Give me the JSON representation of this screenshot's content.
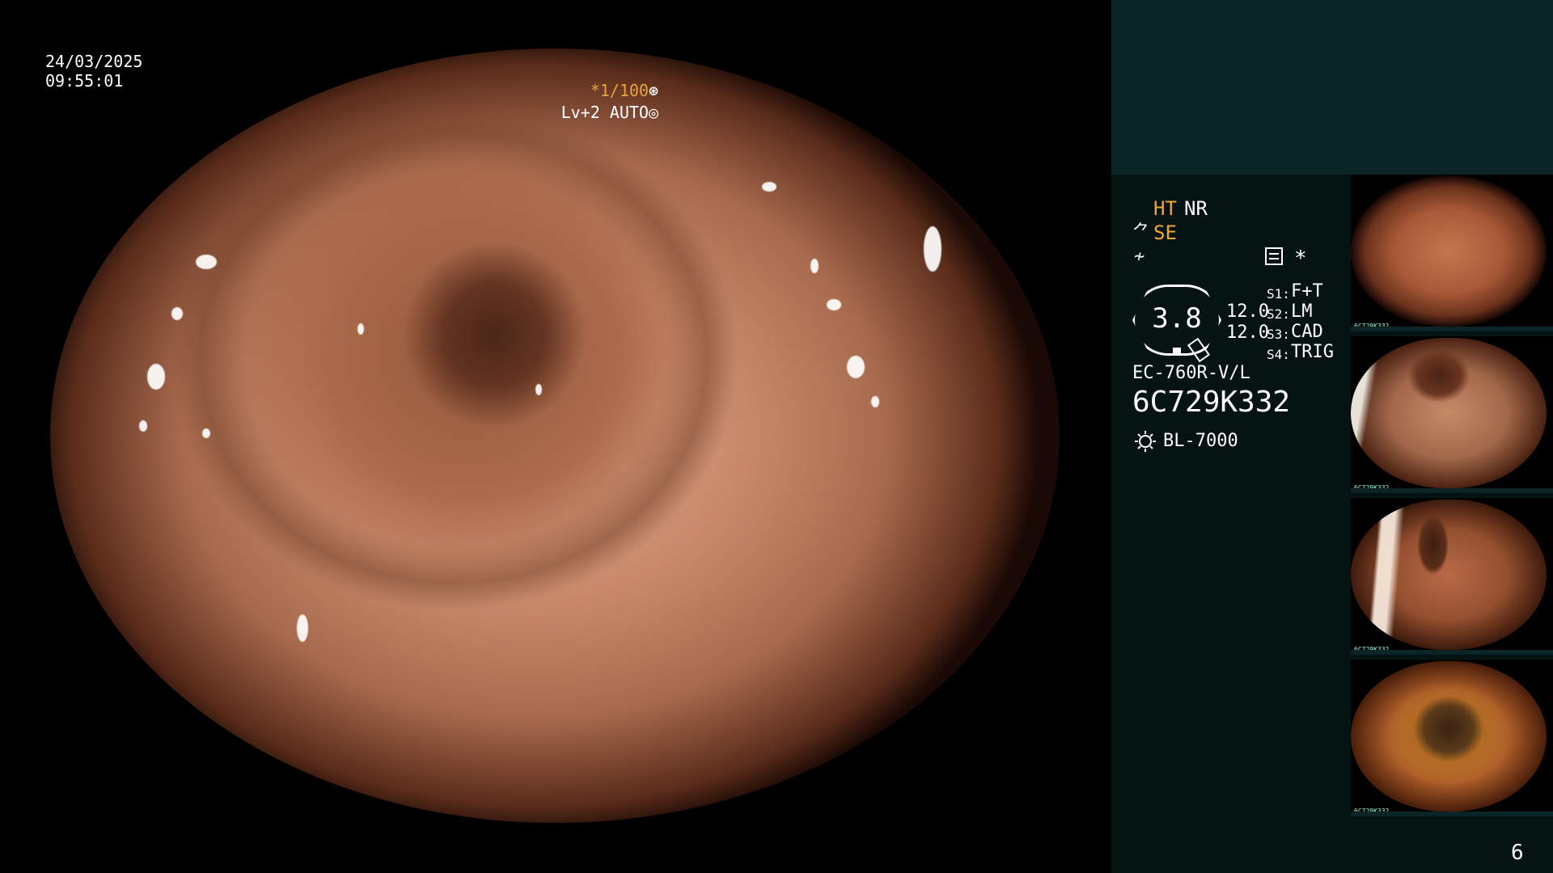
{
  "overlay": {
    "date": "24/03/2025",
    "time": "09:55:01",
    "shutter": "*1/100",
    "level": "Lv+2 AUTO"
  },
  "panel": {
    "mode_ht": "HT",
    "mode_nr": "NR",
    "mode_se": "SE",
    "asterisk": "*",
    "gauge_value": "3.8",
    "value_1": "12.0",
    "value_2": "12.0",
    "switches": [
      {
        "label": "S1:",
        "value": "F+T"
      },
      {
        "label": "S2:",
        "value": "LM"
      },
      {
        "label": "S3:",
        "value": "CAD"
      },
      {
        "label": "S4:",
        "value": "TRIG"
      }
    ],
    "scope_model": "EC-760R-V/L",
    "scope_serial": "6C729K332",
    "light_source": "BL-7000",
    "accent_color": "#f0a830"
  },
  "thumbnails": [
    {
      "tag": "6C729K332"
    },
    {
      "tag": "6C729K332"
    },
    {
      "tag": "6C729K332"
    },
    {
      "tag": "6C729K332"
    }
  ],
  "page_number": "6",
  "icons": {
    "shutter": "aperture-icon",
    "level": "iris-icon",
    "se": "se-icon",
    "freeze": "freeze-icon",
    "memo": "memo-icon",
    "light": "light-source-icon"
  }
}
